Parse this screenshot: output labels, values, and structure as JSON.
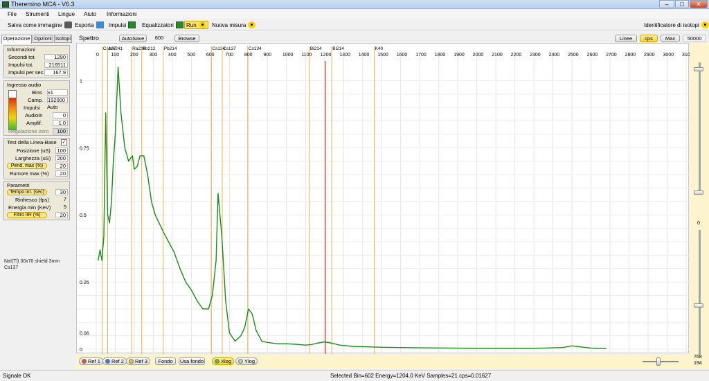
{
  "window": {
    "title": "Theremino MCA - V6.3",
    "min": "–",
    "max": "□",
    "close": "✕"
  },
  "menu": [
    "File",
    "Strumenti",
    "Lingue",
    "Aiuto",
    "Informazioni"
  ],
  "toolbar": {
    "save": "Salva come immagine",
    "export": "Esporta",
    "pulses": "Impulsi",
    "equalizers": "Equalizzatori",
    "run": "Run",
    "new_measure": "Nuova misura",
    "isotope_id": "Identificatore di isotopi"
  },
  "left_tabs": [
    "Operazione",
    "Opzioni",
    "Isotopi"
  ],
  "info": {
    "header": "Informazioni",
    "rows": [
      {
        "label": "Secondi tot.",
        "value": "1290"
      },
      {
        "label": "Impulsi tot.",
        "value": "216511"
      },
      {
        "label": "Impulsi per sec.",
        "value": "167.9"
      }
    ]
  },
  "audio": {
    "header": "Ingresso audio",
    "bins_label": "Bins",
    "bins_value": "x1",
    "camp_label": "Camp.",
    "camp_value": "192000",
    "impulsi_label": "Impulsi",
    "impulsi_value": "Auto",
    "audioin_label": "AudioIn",
    "audioin_value": "0",
    "amplif_label": "Amplif.",
    "amplif_value": "1.0",
    "zero_label": "Regolazione zero",
    "zero_value": "100"
  },
  "baseline": {
    "header": "Test della Linea-Base",
    "checked": "✓",
    "rows": [
      {
        "label": "Posizione (uS)",
        "value": "100"
      },
      {
        "label": "Larghezza (uS)",
        "value": "200"
      },
      {
        "label": "Pend. max (%)",
        "value": "20"
      },
      {
        "label": "Rumore max (%)",
        "value": "20"
      }
    ]
  },
  "params": {
    "header": "Parametri",
    "rows": [
      {
        "label": "Tempo int. (sec)",
        "value": "30"
      },
      {
        "label": "Rinfresco (fps)",
        "value": "7"
      },
      {
        "label": "Energia min (KeV)",
        "value": "5"
      },
      {
        "label": "Filtro IIR (%)",
        "value": "20"
      }
    ]
  },
  "notes": [
    "NaI(Tl) 30x70 shield 3mm",
    "Cs137"
  ],
  "spectrum": {
    "label": "Spettro",
    "autosave": "AutoSave",
    "autosave_value": "600",
    "browse": "Browse",
    "lines": "Linee",
    "cps": "cps",
    "max": "Max",
    "max_value": "50000"
  },
  "chart_data": {
    "type": "line",
    "x_ticks": [
      "0",
      "100",
      "200",
      "300",
      "400",
      "500",
      "600",
      "700",
      "800",
      "900",
      "1000",
      "1100",
      "1200",
      "1300",
      "1400",
      "1500",
      "1600",
      "1700",
      "1800",
      "1900",
      "2000",
      "2100",
      "2200",
      "2300",
      "2400",
      "2500",
      "2600",
      "2700",
      "2800",
      "2900",
      "3000",
      "3100"
    ],
    "y_ticks": [
      "1",
      "0.75",
      "0.5",
      "0.25",
      "0.06",
      "0"
    ],
    "x_range": [
      0,
      3100
    ],
    "y_range": [
      0,
      1.05
    ],
    "isotope_lines": [
      {
        "name": "Cs137",
        "energy": 32
      },
      {
        "name": "Am241",
        "energy": 60
      },
      {
        "name": "Ra226",
        "energy": 186
      },
      {
        "name": "Pb212",
        "energy": 239
      },
      {
        "name": "Pb214",
        "energy": 352
      },
      {
        "name": "Cs134",
        "energy": 605
      },
      {
        "name": "Cs137",
        "energy": 662
      },
      {
        "name": "Cs134",
        "energy": 796
      },
      {
        "name": "Bi214",
        "energy": 1120
      },
      {
        "name": "Bi214",
        "energy": 1238
      },
      {
        "name": "K40",
        "energy": 1461
      }
    ],
    "selected_energy": 1204,
    "series": [
      {
        "x": [
          10,
          20,
          30,
          40,
          50,
          60,
          70,
          80,
          90,
          100,
          115,
          130,
          150,
          170,
          190,
          200,
          215,
          230,
          250,
          270,
          290,
          310,
          330,
          350,
          380,
          410,
          440,
          470,
          500,
          530,
          560,
          590,
          610,
          630,
          640,
          660,
          680,
          700,
          730,
          760,
          780,
          800,
          820,
          840,
          870,
          900,
          950,
          1000,
          1050,
          1100,
          1130,
          1160,
          1200,
          1240,
          1280,
          1350,
          1500,
          1700,
          2000,
          2300,
          2450,
          2500,
          2550,
          2600,
          2680
        ],
        "y": [
          0.33,
          0.37,
          0.33,
          0.42,
          0.88,
          0.5,
          0.47,
          0.55,
          0.7,
          0.8,
          1.05,
          0.88,
          0.75,
          0.7,
          0.72,
          0.67,
          0.68,
          0.72,
          0.72,
          0.65,
          0.55,
          0.5,
          0.47,
          0.44,
          0.4,
          0.36,
          0.3,
          0.25,
          0.22,
          0.18,
          0.15,
          0.15,
          0.2,
          0.33,
          0.58,
          0.42,
          0.18,
          0.06,
          0.03,
          0.05,
          0.08,
          0.15,
          0.13,
          0.07,
          0.03,
          0.025,
          0.02,
          0.02,
          0.018,
          0.015,
          0.017,
          0.022,
          0.027,
          0.022,
          0.015,
          0.01,
          0.007,
          0.005,
          0.003,
          0.003,
          0.006,
          0.012,
          0.008,
          0.004,
          0.002
        ]
      }
    ]
  },
  "bottom": {
    "ref1": "Ref 1",
    "ref2": "Ref 2",
    "ref3": "Ref 3",
    "fondo": "Fondo",
    "usa_fondo": "Usa fondo",
    "xlog": "Xlog",
    "ylog": "Ylog",
    "right_top": "768",
    "right_bottom": "194",
    "right_mid": "0"
  },
  "status": {
    "left": "Signale OK",
    "selected": "Selected Bin=602  Energy=1204.0 KeV  Samples=21  cps=0.01627"
  }
}
